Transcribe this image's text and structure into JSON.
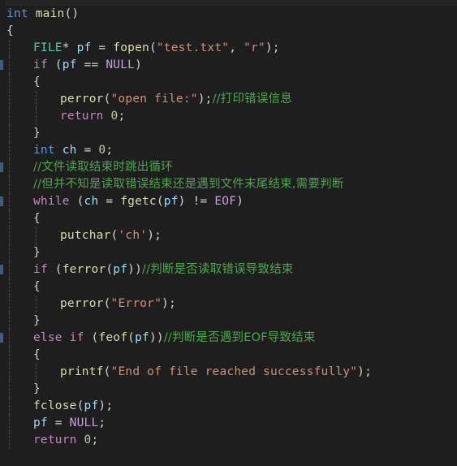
{
  "app": {
    "kind": "code-editor",
    "language": "C",
    "theme": "dark-plus"
  },
  "colors": {
    "background": "#1e1e1e",
    "top_band": "#252526",
    "default_text": "#d4d4d4",
    "keyword": "#569cd6",
    "control_keyword": "#c586c0",
    "function": "#dcdcaa",
    "type": "#4ec9b0",
    "variable": "#9cdcfe",
    "string": "#ce9178",
    "number": "#b5cea8",
    "comment": "#4ea64e",
    "macro": "#c8a0e0",
    "indent_guide": "#5a5a5a",
    "gutter_mark": "#3d5a80"
  },
  "code": {
    "lines": [
      {
        "n": 1,
        "indent": 0,
        "guides": 0,
        "mark": false,
        "tokens": [
          {
            "t": "int",
            "c": "kw"
          },
          {
            "t": " ",
            "c": "punc"
          },
          {
            "t": "main",
            "c": "fn"
          },
          {
            "t": "()",
            "c": "punc"
          }
        ]
      },
      {
        "n": 2,
        "indent": 0,
        "guides": 0,
        "mark": false,
        "tokens": [
          {
            "t": "{",
            "c": "punc"
          }
        ]
      },
      {
        "n": 3,
        "indent": 1,
        "guides": 1,
        "mark": false,
        "tokens": [
          {
            "t": "FILE",
            "c": "type"
          },
          {
            "t": "* ",
            "c": "punc"
          },
          {
            "t": "pf",
            "c": "var"
          },
          {
            "t": " = ",
            "c": "punc"
          },
          {
            "t": "fopen",
            "c": "fn"
          },
          {
            "t": "(",
            "c": "punc"
          },
          {
            "t": "\"test.txt\"",
            "c": "str"
          },
          {
            "t": ", ",
            "c": "punc"
          },
          {
            "t": "\"r\"",
            "c": "str"
          },
          {
            "t": ");",
            "c": "punc"
          }
        ]
      },
      {
        "n": 4,
        "indent": 1,
        "guides": 1,
        "mark": true,
        "tokens": [
          {
            "t": "if",
            "c": "ctl"
          },
          {
            "t": " (",
            "c": "punc"
          },
          {
            "t": "pf",
            "c": "var"
          },
          {
            "t": " == ",
            "c": "punc"
          },
          {
            "t": "NULL",
            "c": "mac"
          },
          {
            "t": ")",
            "c": "punc"
          }
        ]
      },
      {
        "n": 5,
        "indent": 1,
        "guides": 1,
        "mark": false,
        "tokens": [
          {
            "t": "{",
            "c": "punc"
          }
        ]
      },
      {
        "n": 6,
        "indent": 2,
        "guides": 2,
        "mark": false,
        "tokens": [
          {
            "t": "perror",
            "c": "fn"
          },
          {
            "t": "(",
            "c": "punc"
          },
          {
            "t": "\"open file:\"",
            "c": "str"
          },
          {
            "t": ");",
            "c": "punc"
          },
          {
            "t": "//打印错误信息",
            "c": "cmt cjk"
          }
        ]
      },
      {
        "n": 7,
        "indent": 2,
        "guides": 2,
        "mark": false,
        "tokens": [
          {
            "t": "return",
            "c": "ctl"
          },
          {
            "t": " ",
            "c": "punc"
          },
          {
            "t": "0",
            "c": "num"
          },
          {
            "t": ";",
            "c": "punc"
          }
        ]
      },
      {
        "n": 8,
        "indent": 1,
        "guides": 1,
        "mark": false,
        "tokens": [
          {
            "t": "}",
            "c": "punc"
          }
        ]
      },
      {
        "n": 9,
        "indent": 1,
        "guides": 1,
        "mark": false,
        "tokens": [
          {
            "t": "int",
            "c": "kw"
          },
          {
            "t": " ",
            "c": "punc"
          },
          {
            "t": "ch",
            "c": "var"
          },
          {
            "t": " = ",
            "c": "punc"
          },
          {
            "t": "0",
            "c": "num"
          },
          {
            "t": ";",
            "c": "punc"
          }
        ]
      },
      {
        "n": 10,
        "indent": 1,
        "guides": 1,
        "mark": true,
        "tokens": [
          {
            "t": "//文件读取结束时跳出循环",
            "c": "cmt cjk"
          }
        ]
      },
      {
        "n": 11,
        "indent": 1,
        "guides": 1,
        "mark": false,
        "tokens": [
          {
            "t": "//但并不知是读取错误结束还是遇到文件末尾结束,需要判断",
            "c": "cmt cjk"
          }
        ]
      },
      {
        "n": 12,
        "indent": 1,
        "guides": 1,
        "mark": true,
        "tokens": [
          {
            "t": "while",
            "c": "ctl"
          },
          {
            "t": " (",
            "c": "punc"
          },
          {
            "t": "ch",
            "c": "var"
          },
          {
            "t": " = ",
            "c": "punc"
          },
          {
            "t": "fgetc",
            "c": "fn"
          },
          {
            "t": "(",
            "c": "punc"
          },
          {
            "t": "pf",
            "c": "var"
          },
          {
            "t": ") != ",
            "c": "punc"
          },
          {
            "t": "EOF",
            "c": "mac"
          },
          {
            "t": ")",
            "c": "punc"
          }
        ]
      },
      {
        "n": 13,
        "indent": 1,
        "guides": 1,
        "mark": false,
        "tokens": [
          {
            "t": "{",
            "c": "punc"
          }
        ]
      },
      {
        "n": 14,
        "indent": 2,
        "guides": 2,
        "mark": false,
        "tokens": [
          {
            "t": "putchar",
            "c": "fn"
          },
          {
            "t": "(",
            "c": "punc"
          },
          {
            "t": "'ch'",
            "c": "str"
          },
          {
            "t": ");",
            "c": "punc"
          }
        ]
      },
      {
        "n": 15,
        "indent": 1,
        "guides": 1,
        "mark": false,
        "tokens": [
          {
            "t": "}",
            "c": "punc"
          }
        ]
      },
      {
        "n": 16,
        "indent": 1,
        "guides": 1,
        "mark": true,
        "tokens": [
          {
            "t": "if",
            "c": "ctl"
          },
          {
            "t": " (",
            "c": "punc"
          },
          {
            "t": "ferror",
            "c": "fn"
          },
          {
            "t": "(",
            "c": "punc"
          },
          {
            "t": "pf",
            "c": "var"
          },
          {
            "t": "))",
            "c": "punc"
          },
          {
            "t": "//判断是否读取错误导致结束",
            "c": "cmt cjk"
          }
        ]
      },
      {
        "n": 17,
        "indent": 1,
        "guides": 1,
        "mark": false,
        "tokens": [
          {
            "t": "{",
            "c": "punc"
          }
        ]
      },
      {
        "n": 18,
        "indent": 2,
        "guides": 2,
        "mark": false,
        "tokens": [
          {
            "t": "perror",
            "c": "fn"
          },
          {
            "t": "(",
            "c": "punc"
          },
          {
            "t": "\"Error\"",
            "c": "str"
          },
          {
            "t": ");",
            "c": "punc"
          }
        ]
      },
      {
        "n": 19,
        "indent": 1,
        "guides": 1,
        "mark": false,
        "tokens": [
          {
            "t": "}",
            "c": "punc"
          }
        ]
      },
      {
        "n": 20,
        "indent": 1,
        "guides": 1,
        "mark": true,
        "tokens": [
          {
            "t": "else",
            "c": "ctl"
          },
          {
            "t": " ",
            "c": "punc"
          },
          {
            "t": "if",
            "c": "ctl"
          },
          {
            "t": " (",
            "c": "punc"
          },
          {
            "t": "feof",
            "c": "fn"
          },
          {
            "t": "(",
            "c": "punc"
          },
          {
            "t": "pf",
            "c": "var"
          },
          {
            "t": "))",
            "c": "punc"
          },
          {
            "t": "//判断是否遇到EOF导致结束",
            "c": "cmt cjk"
          }
        ]
      },
      {
        "n": 21,
        "indent": 1,
        "guides": 1,
        "mark": false,
        "tokens": [
          {
            "t": "{",
            "c": "punc"
          }
        ]
      },
      {
        "n": 22,
        "indent": 2,
        "guides": 2,
        "mark": false,
        "tokens": [
          {
            "t": "printf",
            "c": "fn"
          },
          {
            "t": "(",
            "c": "punc"
          },
          {
            "t": "\"End of file reached successfully\"",
            "c": "str"
          },
          {
            "t": ");",
            "c": "punc"
          }
        ]
      },
      {
        "n": 23,
        "indent": 1,
        "guides": 1,
        "mark": false,
        "tokens": [
          {
            "t": "}",
            "c": "punc"
          }
        ]
      },
      {
        "n": 24,
        "indent": 1,
        "guides": 1,
        "mark": false,
        "tokens": [
          {
            "t": "fclose",
            "c": "fn"
          },
          {
            "t": "(",
            "c": "punc"
          },
          {
            "t": "pf",
            "c": "var"
          },
          {
            "t": ");",
            "c": "punc"
          }
        ]
      },
      {
        "n": 25,
        "indent": 1,
        "guides": 1,
        "mark": false,
        "tokens": [
          {
            "t": "pf",
            "c": "var"
          },
          {
            "t": " = ",
            "c": "punc"
          },
          {
            "t": "NULL",
            "c": "mac"
          },
          {
            "t": ";",
            "c": "punc"
          }
        ]
      },
      {
        "n": 26,
        "indent": 1,
        "guides": 1,
        "mark": false,
        "tokens": [
          {
            "t": "return",
            "c": "ctl"
          },
          {
            "t": " ",
            "c": "punc"
          },
          {
            "t": "0",
            "c": "num"
          },
          {
            "t": ";",
            "c": "punc"
          }
        ]
      }
    ]
  }
}
